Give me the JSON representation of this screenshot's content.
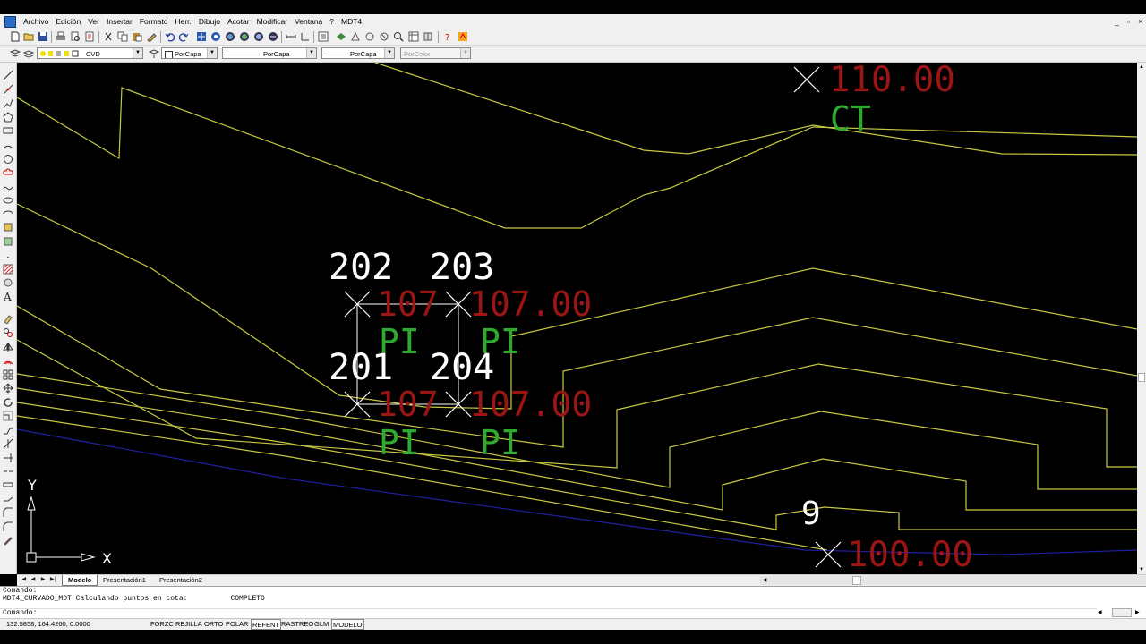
{
  "menu": {
    "items": [
      "Archivo",
      "Edición",
      "Ver",
      "Insertar",
      "Formato",
      "Herr.",
      "Dibujo",
      "Acotar",
      "Modificar",
      "Ventana",
      "?",
      "MDT4"
    ]
  },
  "props": {
    "layer": "CVD",
    "layer_color": "PorCapa",
    "linetype": "PorCapa",
    "lineweight": "PorCapa",
    "plotstyle": "PorColor"
  },
  "drawing": {
    "top_elevation": "110.00",
    "top_code": "CT",
    "point_202": "202",
    "point_203": "203",
    "point_201": "201",
    "point_204": "204",
    "elev_a": "107",
    "elev_b": "107.00",
    "elev_c": "107",
    "elev_d": "107.00",
    "pi_code": "PI",
    "point_9": "9",
    "bottom_elevation": "100.00",
    "ucs_y": "Y",
    "ucs_x": "X",
    "colors": {
      "contour": "#c8c840",
      "label": "#ffffff",
      "elevation": "#9b1515",
      "code": "#2eab2e",
      "blue_line": "#2020a0"
    }
  },
  "tabs": {
    "model": "Modelo",
    "layout1": "Presentación1",
    "layout2": "Presentación2"
  },
  "command": {
    "line1": "Comando:",
    "line2": "MDT4_CURVADO_MDT Calculando puntos en cota:          COMPLETO",
    "prompt": "Comando:"
  },
  "status": {
    "coords": "132.5858, 164.4260, 0.0000",
    "forzc": "FORZC",
    "rejilla": "REJILLA",
    "orto": "ORTO",
    "polar": "POLAR",
    "refent": "REFENT",
    "rastreo": "RASTREO",
    "glm": "GLM",
    "modelo": "MODELO"
  }
}
